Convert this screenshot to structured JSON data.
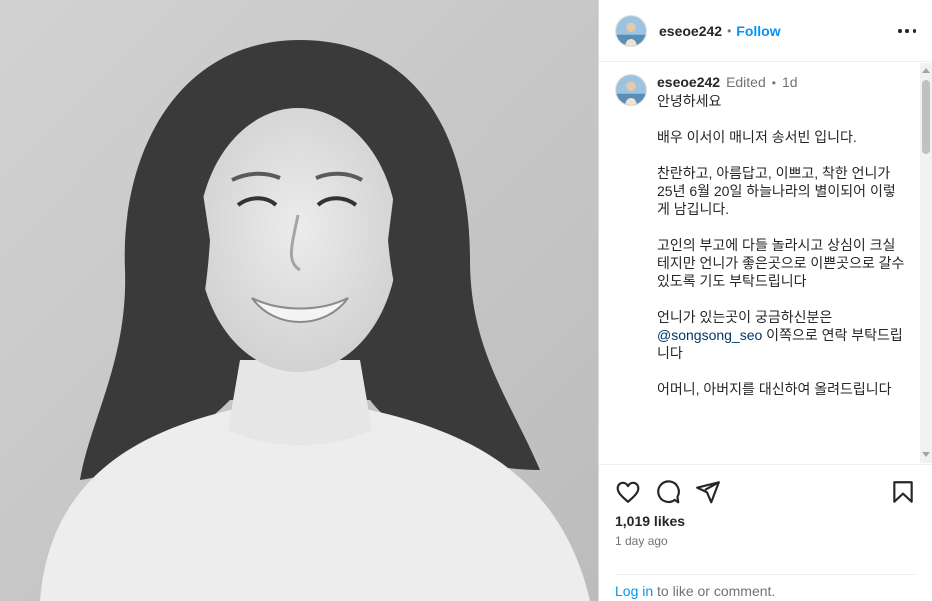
{
  "post": {
    "username": "eseoe242",
    "follow_label": "Follow",
    "separator": "•",
    "photo_icon": "portrait-photo"
  },
  "caption": {
    "username": "eseoe242",
    "edited_label": "Edited",
    "separator": "•",
    "age": "1d",
    "paragraphs": [
      "안녕하세요",
      "배우 이서이 매니저 송서빈 입니다.",
      "찬란하고, 아름답고, 이쁘고, 착한 언니가\n25년 6월 20일 하늘나라의 별이되어 이렇게 남깁니다.",
      "고인의 부고에 다들 놀라시고 상심이 크실테지만 언니가 좋은곳으로 이쁜곳으로 갈수있도록 기도 부탁드립니다"
    ],
    "mention_before": "언니가 있는곳이 궁금하신분은",
    "mention": "@songsong_seo",
    "mention_after": " 이쪽으로 연락 부탁드립니다",
    "last_paragraph": "어머니, 아버지를 대신하여 올려드립니다"
  },
  "actions": {
    "icons": [
      "heart-icon",
      "comment-icon",
      "share-icon",
      "bookmark-icon"
    ],
    "likes": "1,019 likes",
    "time": "1 day ago",
    "login_link": "Log in",
    "login_rest": " to like or comment."
  },
  "colors": {
    "accent": "#0095f6",
    "text": "#262626",
    "muted": "#737373",
    "mention": "#00376b"
  }
}
